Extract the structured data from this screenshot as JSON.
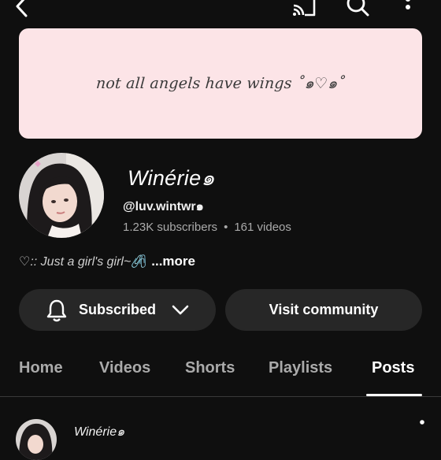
{
  "banner": {
    "text": "not all angels have wings ˚๑♡๑˚"
  },
  "channel": {
    "name": "Winérie๑",
    "handle": "@luv.wintwr๑",
    "subscribers": "1.23K subscribers",
    "separator": "•",
    "videos": "161 videos",
    "bio_text": "♡:: Just a girl's girl~🖇️",
    "bio_more": "...more"
  },
  "actions": {
    "subscribed_label": "Subscribed",
    "community_label": "Visit community"
  },
  "tabs": [
    {
      "label": "Home"
    },
    {
      "label": "Videos"
    },
    {
      "label": "Shorts"
    },
    {
      "label": "Playlists"
    },
    {
      "label": "Posts",
      "active": true
    }
  ],
  "post": {
    "author": "Winérie๑"
  },
  "icons": {
    "back": "back-arrow-icon",
    "cast": "cast-icon",
    "search": "search-icon",
    "more": "more-vert-icon",
    "bell": "bell-icon",
    "chevron": "chevron-down-icon"
  },
  "colors": {
    "background": "#0f0f0f",
    "banner": "#fce4e7",
    "pill": "#272727",
    "muted_text": "#aaaaaa"
  }
}
